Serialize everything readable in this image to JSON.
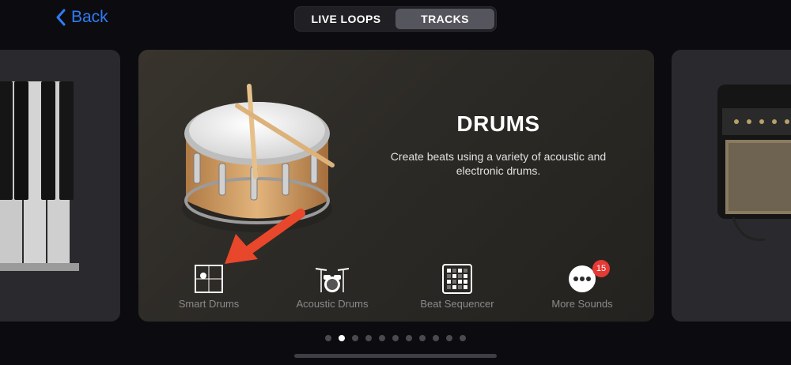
{
  "nav": {
    "back_label": "Back",
    "tabs": [
      {
        "label": "LIVE LOOPS",
        "active": false
      },
      {
        "label": "TRACKS",
        "active": true
      }
    ]
  },
  "card": {
    "title": "DRUMS",
    "description": "Create beats using a variety of acoustic and electronic drums.",
    "options": [
      {
        "label": "Smart Drums",
        "icon": "smart-drums-icon"
      },
      {
        "label": "Acoustic Drums",
        "icon": "drum-kit-icon"
      },
      {
        "label": "Beat Sequencer",
        "icon": "beat-sequencer-icon"
      },
      {
        "label": "More Sounds",
        "icon": "more-sounds-icon",
        "badge": "15"
      }
    ]
  },
  "pagination": {
    "count": 11,
    "active_index": 1
  },
  "colors": {
    "accent": "#2f7cf6",
    "badge": "#e53a35",
    "arrow": "#e8472b"
  }
}
